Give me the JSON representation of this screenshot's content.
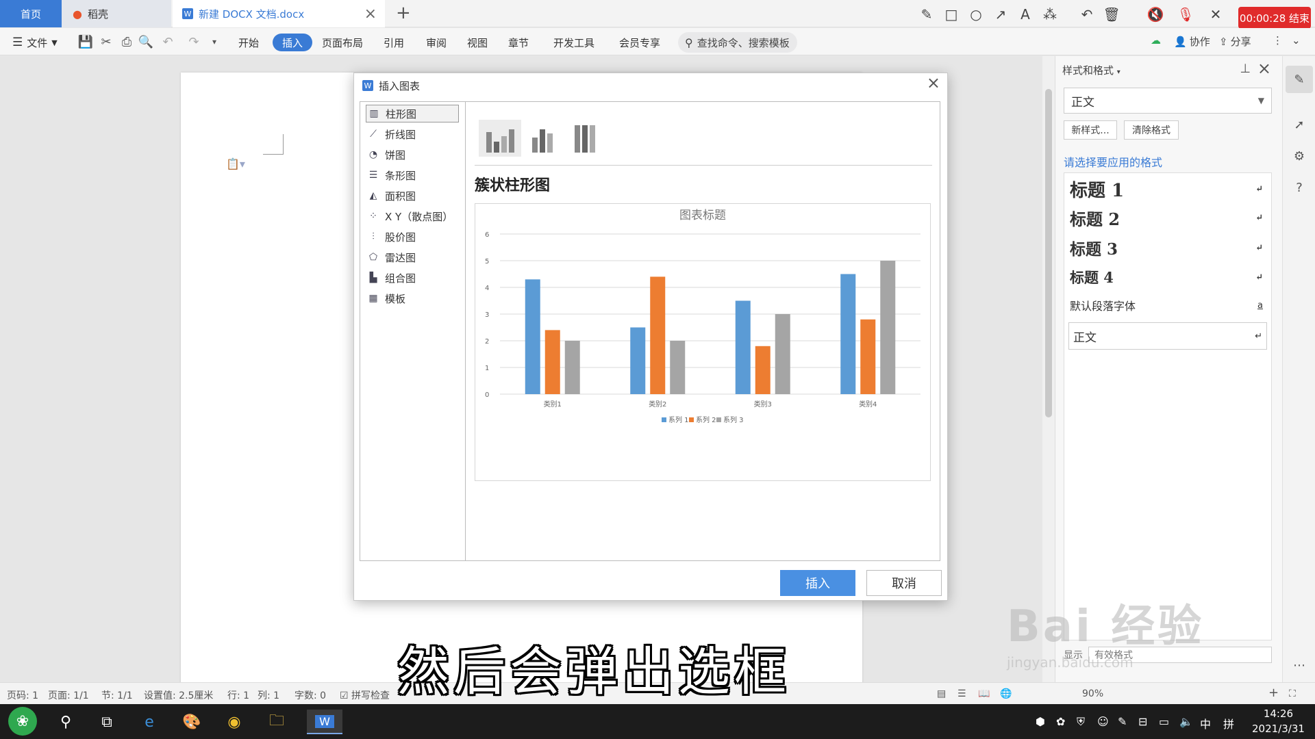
{
  "tabs": {
    "home": "首页",
    "daoke": "稻壳",
    "doc": "新建 DOCX 文档.docx"
  },
  "record": {
    "label": "00:00:28 结束"
  },
  "menu": {
    "file": "文件",
    "items": [
      "开始",
      "插入",
      "页面布局",
      "引用",
      "审阅",
      "视图",
      "章节",
      "开发工具",
      "会员专享"
    ],
    "active": "插入",
    "search_placeholder": "查找命令、搜索模板",
    "collab": "协作",
    "share": "分享"
  },
  "dialog": {
    "title": "插入图表",
    "categories": [
      "柱形图",
      "折线图",
      "饼图",
      "条形图",
      "面积图",
      "X Y（散点图）",
      "股价图",
      "雷达图",
      "组合图",
      "模板"
    ],
    "selected_type_name": "簇状柱形图",
    "insert_label": "插入",
    "cancel_label": "取消"
  },
  "chart_data": {
    "type": "bar",
    "title": "图表标题",
    "categories": [
      "类别1",
      "类别2",
      "类别3",
      "类别4"
    ],
    "series": [
      {
        "name": "系列 1",
        "values": [
          4.3,
          2.5,
          3.5,
          4.5
        ],
        "color": "#5b9bd5"
      },
      {
        "name": "系列 2",
        "values": [
          2.4,
          4.4,
          1.8,
          2.8
        ],
        "color": "#ed7d31"
      },
      {
        "name": "系列 3",
        "values": [
          2,
          2,
          3,
          5
        ],
        "color": "#a5a5a5"
      }
    ],
    "ylim": [
      0,
      6
    ],
    "yticks": [
      "0",
      "1",
      "2",
      "3",
      "4",
      "5",
      "6"
    ],
    "legend": "bottom",
    "grid": true
  },
  "panel": {
    "title": "样式和格式",
    "current_style": "正文",
    "new_style": "新样式...",
    "clear_format": "清除格式",
    "hint": "请选择要应用的格式",
    "styles": [
      {
        "label": "标题  1"
      },
      {
        "label": "标题  2"
      },
      {
        "label": "标题  3"
      },
      {
        "label": "标题  4"
      },
      {
        "label": "默认段落字体"
      },
      {
        "label": "正文"
      }
    ],
    "footer_show": "显示",
    "footer_value": "有效格式"
  },
  "status": {
    "page": "页码: 1",
    "pages": "页面: 1/1",
    "section": "节: 1/1",
    "setting": "设置值: 2.5厘米",
    "row": "行: 1",
    "col": "列: 1",
    "words": "字数: 0",
    "spell": "拼写检查",
    "zoom": "90%"
  },
  "subtitle": "然后会弹出选框",
  "watermark": {
    "brand": "Bai 经验",
    "url": "jingyan.baidu.com"
  },
  "taskbar": {
    "time": "14:26",
    "date": "2021/3/31",
    "ime": "中",
    "ime2": "拼"
  }
}
